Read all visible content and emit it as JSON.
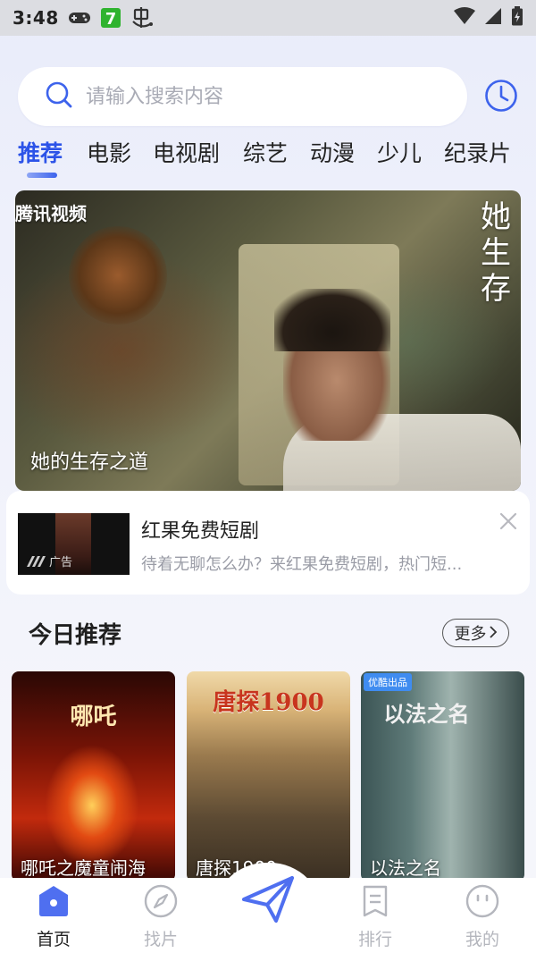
{
  "status_bar": {
    "time": "3:48"
  },
  "search": {
    "placeholder": "请输入搜索内容"
  },
  "tabs": [
    {
      "label": "推荐"
    },
    {
      "label": "电影"
    },
    {
      "label": "电视剧"
    },
    {
      "label": "综艺"
    },
    {
      "label": "动漫"
    },
    {
      "label": "少儿"
    },
    {
      "label": "纪录片"
    }
  ],
  "banner": {
    "brand": "腾讯视频",
    "vertical_title": "她生存",
    "caption": "她的生存之道"
  },
  "ad": {
    "title": "红果免费短剧",
    "description": "待着无聊怎么办？来红果免费短剧，热门短...",
    "badge": "广告"
  },
  "today": {
    "title": "今日推荐",
    "more": "更多"
  },
  "posters": [
    {
      "title": "哪吒之魔童闹海",
      "art_text": "哪吒"
    },
    {
      "title": "唐探1900",
      "art_text": "唐探1900"
    },
    {
      "title": "以法之名",
      "art_text": "以法之名",
      "chip": "优酷出品"
    }
  ],
  "bottom_nav": [
    {
      "label": "首页"
    },
    {
      "label": "找片"
    },
    {
      "label": "排行"
    },
    {
      "label": "我的"
    }
  ],
  "colors": {
    "accent": "#2c53e8",
    "inactive": "#b4b6bd"
  }
}
